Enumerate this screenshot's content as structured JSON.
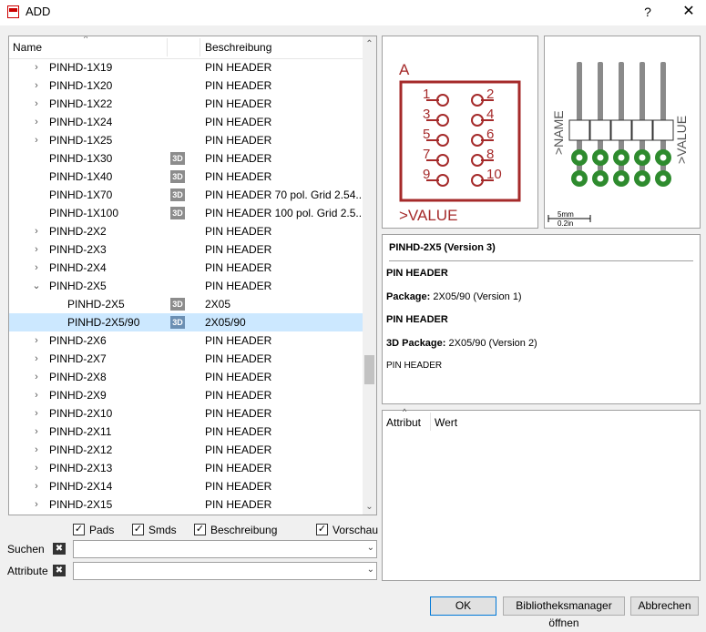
{
  "window": {
    "title": "ADD",
    "help": "?",
    "close": "✕"
  },
  "tree": {
    "columns": {
      "name": "Name",
      "description": "Beschreibung"
    },
    "rows": [
      {
        "name": "PINHD-1X19",
        "desc": "PIN HEADER",
        "level": 1,
        "expander": "collapsed",
        "has3d": false
      },
      {
        "name": "PINHD-1X20",
        "desc": "PIN HEADER",
        "level": 1,
        "expander": "collapsed",
        "has3d": false
      },
      {
        "name": "PINHD-1X22",
        "desc": "PIN HEADER",
        "level": 1,
        "expander": "collapsed",
        "has3d": false
      },
      {
        "name": "PINHD-1X24",
        "desc": "PIN HEADER",
        "level": 1,
        "expander": "collapsed",
        "has3d": false
      },
      {
        "name": "PINHD-1X25",
        "desc": "PIN HEADER",
        "level": 1,
        "expander": "collapsed",
        "has3d": false
      },
      {
        "name": "PINHD-1X30",
        "desc": "PIN HEADER",
        "level": 1,
        "expander": "none",
        "has3d": true
      },
      {
        "name": "PINHD-1X40",
        "desc": "PIN HEADER",
        "level": 1,
        "expander": "none",
        "has3d": true
      },
      {
        "name": "PINHD-1X70",
        "desc": "PIN HEADER 70 pol. Grid 2.54...",
        "level": 1,
        "expander": "none",
        "has3d": true
      },
      {
        "name": "PINHD-1X100",
        "desc": "PIN HEADER 100 pol. Grid 2.5...",
        "level": 1,
        "expander": "none",
        "has3d": true
      },
      {
        "name": "PINHD-2X2",
        "desc": "PIN HEADER",
        "level": 1,
        "expander": "collapsed",
        "has3d": false
      },
      {
        "name": "PINHD-2X3",
        "desc": "PIN HEADER",
        "level": 1,
        "expander": "collapsed",
        "has3d": false
      },
      {
        "name": "PINHD-2X4",
        "desc": "PIN HEADER",
        "level": 1,
        "expander": "collapsed",
        "has3d": false
      },
      {
        "name": "PINHD-2X5",
        "desc": "PIN HEADER",
        "level": 1,
        "expander": "expanded",
        "has3d": false
      },
      {
        "name": "PINHD-2X5",
        "desc": "2X05",
        "level": 2,
        "expander": "none",
        "has3d": true
      },
      {
        "name": "PINHD-2X5/90",
        "desc": "2X05/90",
        "level": 2,
        "expander": "none",
        "has3d": true,
        "selected": true
      },
      {
        "name": "PINHD-2X6",
        "desc": "PIN HEADER",
        "level": 1,
        "expander": "collapsed",
        "has3d": false
      },
      {
        "name": "PINHD-2X7",
        "desc": "PIN HEADER",
        "level": 1,
        "expander": "collapsed",
        "has3d": false
      },
      {
        "name": "PINHD-2X8",
        "desc": "PIN HEADER",
        "level": 1,
        "expander": "collapsed",
        "has3d": false
      },
      {
        "name": "PINHD-2X9",
        "desc": "PIN HEADER",
        "level": 1,
        "expander": "collapsed",
        "has3d": false
      },
      {
        "name": "PINHD-2X10",
        "desc": "PIN HEADER",
        "level": 1,
        "expander": "collapsed",
        "has3d": false
      },
      {
        "name": "PINHD-2X11",
        "desc": "PIN HEADER",
        "level": 1,
        "expander": "collapsed",
        "has3d": false
      },
      {
        "name": "PINHD-2X12",
        "desc": "PIN HEADER",
        "level": 1,
        "expander": "collapsed",
        "has3d": false
      },
      {
        "name": "PINHD-2X13",
        "desc": "PIN HEADER",
        "level": 1,
        "expander": "collapsed",
        "has3d": false
      },
      {
        "name": "PINHD-2X14",
        "desc": "PIN HEADER",
        "level": 1,
        "expander": "collapsed",
        "has3d": false
      },
      {
        "name": "PINHD-2X15",
        "desc": "PIN HEADER",
        "level": 1,
        "expander": "collapsed",
        "has3d": false
      }
    ],
    "badge_text": "3D"
  },
  "options": [
    {
      "label": "Pads",
      "checked": true
    },
    {
      "label": "Smds",
      "checked": true
    },
    {
      "label": "Beschreibung",
      "checked": true
    },
    {
      "label": "Vorschau",
      "checked": true
    }
  ],
  "search": {
    "label": "Suchen",
    "value": ""
  },
  "attribute_filter": {
    "label": "Attribute",
    "value": ""
  },
  "symbol_preview": {
    "part_label": "A",
    "value_label": ">VALUE",
    "pins_left": [
      "1",
      "3",
      "5",
      "7",
      "9"
    ],
    "pins_right": [
      "2",
      "4",
      "6",
      "8",
      "10"
    ],
    "color": "#a52a2a"
  },
  "package_preview": {
    "name_label": ">NAME",
    "value_label": ">VALUE",
    "scale_mm": "5mm",
    "scale_in": "0.2in",
    "pad_color": "#2e8b2e",
    "pin_color": "#8a8a8a"
  },
  "description": {
    "title": "PINHD-2X5 (Version 3)",
    "line1": "PIN HEADER",
    "package_key": "Package:",
    "package_val": " 2X05/90 (Version 1)",
    "line2": "PIN HEADER",
    "pkg3d_key": "3D Package:",
    "pkg3d_val": " 2X05/90 (Version 2)",
    "line3": "PIN HEADER"
  },
  "attributes": {
    "col_attribute": "Attribut",
    "col_value": "Wert"
  },
  "buttons": {
    "ok": "OK",
    "library_manager": "Bibliotheksmanager öffnen",
    "cancel": "Abbrechen"
  }
}
